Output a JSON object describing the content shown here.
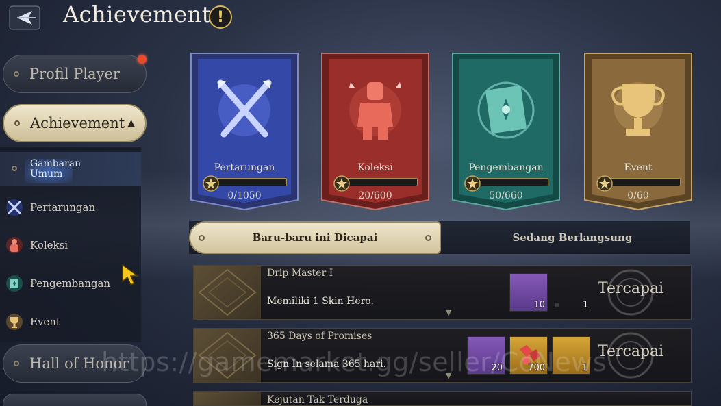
{
  "header": {
    "title": "Achievement",
    "back_icon": "back-arrow-icon",
    "info_icon": "exclamation-icon",
    "info_symbol": "!"
  },
  "sidebar": {
    "profile": "Profil Player",
    "achievement": "Achievement",
    "achievement_caret": "▲",
    "overview": "Gambaran Umum",
    "sub_items": [
      {
        "label": "Pertarungan",
        "icon": "crossed-swords-icon"
      },
      {
        "label": "Koleksi",
        "icon": "knight-icon"
      },
      {
        "label": "Pengembangan",
        "icon": "book-icon"
      },
      {
        "label": "Event",
        "icon": "trophy-icon"
      }
    ],
    "hall_of_honor": "Hall of Honor"
  },
  "categories": [
    {
      "label": "Pertarungan",
      "progress_text": "0/1050",
      "progress": 0.0,
      "color": "#3448a8",
      "icon": "crossed-swords-icon"
    },
    {
      "label": "Koleksi",
      "progress_text": "20/600",
      "progress": 0.033,
      "color": "#9a2e2a",
      "icon": "knight-icon"
    },
    {
      "label": "Pengembangan",
      "progress_text": "50/660",
      "progress": 0.076,
      "color": "#1f6a64",
      "icon": "book-icon"
    },
    {
      "label": "Event",
      "progress_text": "0/60",
      "progress": 0.0,
      "color": "#8a6a3c",
      "icon": "trophy-icon"
    }
  ],
  "tabs": {
    "recent": "Baru-baru ini Dicapai",
    "ongoing": "Sedang Berlangsung"
  },
  "achievements": [
    {
      "title": "Drip Master I",
      "description": "Memiliki 1 Skin Hero.",
      "status": "Tercapai",
      "rewards": [
        {
          "type": "purple",
          "qty": "10"
        }
      ],
      "extra_qty": "1"
    },
    {
      "title": "365 Days of Promises",
      "description": "Sign In selama 365 hari.",
      "status": "Tercapai",
      "rewards": [
        {
          "type": "purple",
          "qty": "20"
        },
        {
          "type": "gold",
          "qty": "700",
          "icon": "ruby-icon"
        },
        {
          "type": "gold",
          "qty": "1"
        }
      ]
    },
    {
      "title": "Kejutan Tak Terduga"
    }
  ],
  "watermark": "https://gamemarket.gg/seller/CoNews"
}
